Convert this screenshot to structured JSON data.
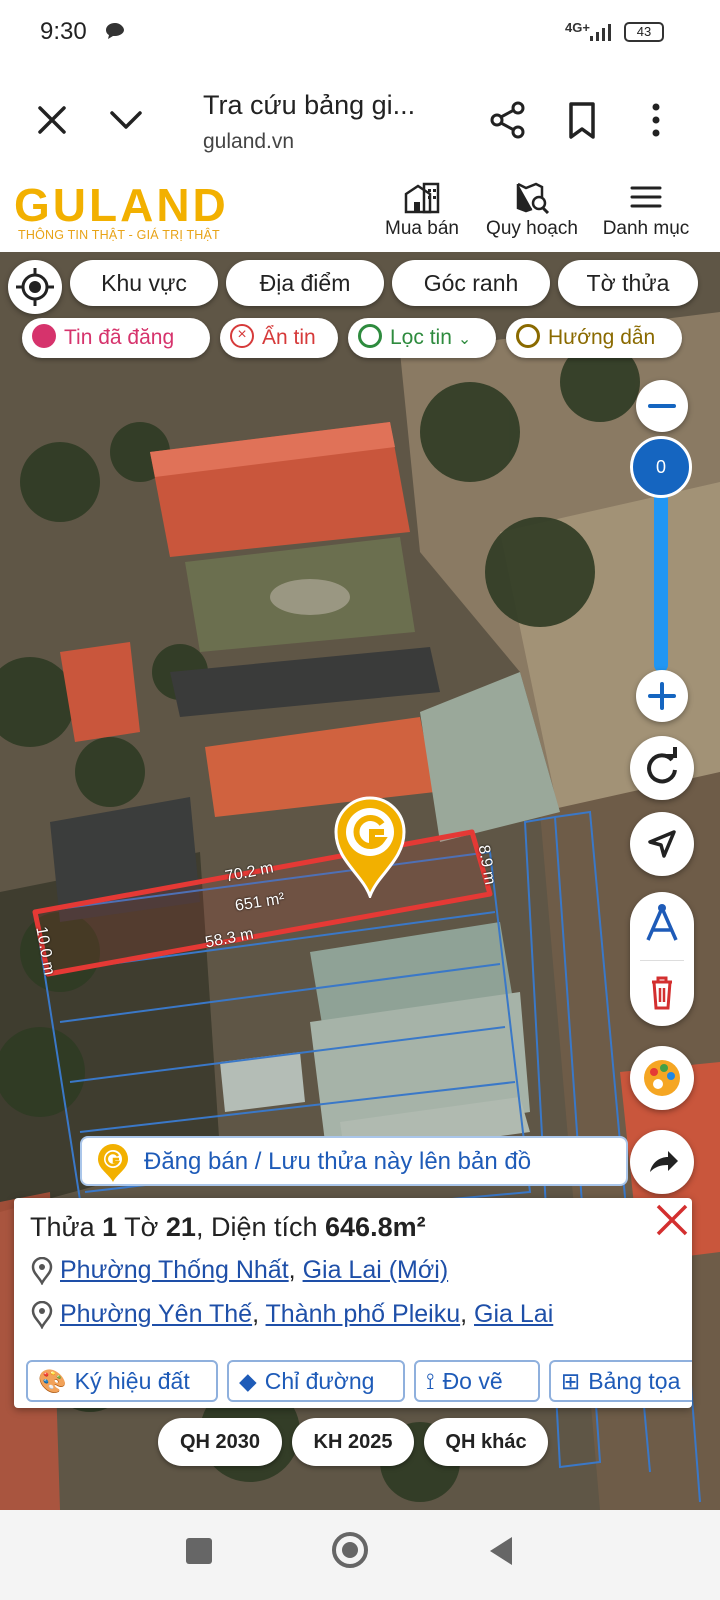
{
  "status_bar": {
    "time": "9:30",
    "network": "4G+",
    "battery": "43"
  },
  "browser": {
    "title": "Tra cứu bảng gi...",
    "domain": "guland.vn"
  },
  "site_header": {
    "logo": "GULAND",
    "tagline": "THÔNG TIN THẬT - GIÁ TRỊ THẬT",
    "nav": [
      {
        "label": "Mua bán",
        "icon": "building-icon"
      },
      {
        "label": "Quy hoạch",
        "icon": "map-search-icon"
      },
      {
        "label": "Danh mục",
        "icon": "menu-icon"
      }
    ]
  },
  "search_pills": [
    "Khu vực",
    "Địa điểm",
    "Góc ranh",
    "Tờ thửa"
  ],
  "filter_chips": [
    {
      "label": "Tin đã đăng",
      "color": "#D6336C",
      "icon": "posted-icon"
    },
    {
      "label": "Ẩn tin",
      "color": "#D63A3A",
      "icon": "hide-icon"
    },
    {
      "label": "Lọc tin",
      "color": "#2E8B3E",
      "icon": "filter-pin-icon"
    },
    {
      "label": "Hướng dẫn",
      "color": "#8A6A00",
      "icon": "guide-play-icon"
    }
  ],
  "zoom": {
    "value": "0"
  },
  "parcel": {
    "length_top": "70.2 m",
    "area_label": "651 m²",
    "length_bottom": "58.3 m",
    "width_left": "10.0 m",
    "width_right": "8.9 m"
  },
  "promo_text": "Đăng bán / Lưu thửa này lên bản đồ",
  "info": {
    "thua_label": "Thửa",
    "thua_value": "1",
    "to_label": "Tờ",
    "to_value": "21",
    "area_label": ", Diện tích",
    "area_value": "646.8m²",
    "location_new": {
      "ward": "Phường Thống Nhất",
      "province": "Gia Lai (Mới)"
    },
    "location_old": {
      "ward": "Phường Yên Thế",
      "city": "Thành phố Pleiku",
      "province": "Gia Lai"
    },
    "actions": [
      "Ký hiệu đất",
      "Chỉ đường",
      "Đo vẽ",
      "Bảng tọa"
    ]
  },
  "plan_buttons": [
    "QH 2030",
    "KH 2025",
    "QH khác"
  ],
  "colors": {
    "brand": "#F2B000",
    "link": "#1E4FA8",
    "parcel_outline": "#E53935",
    "zoom": "#1565C0"
  }
}
